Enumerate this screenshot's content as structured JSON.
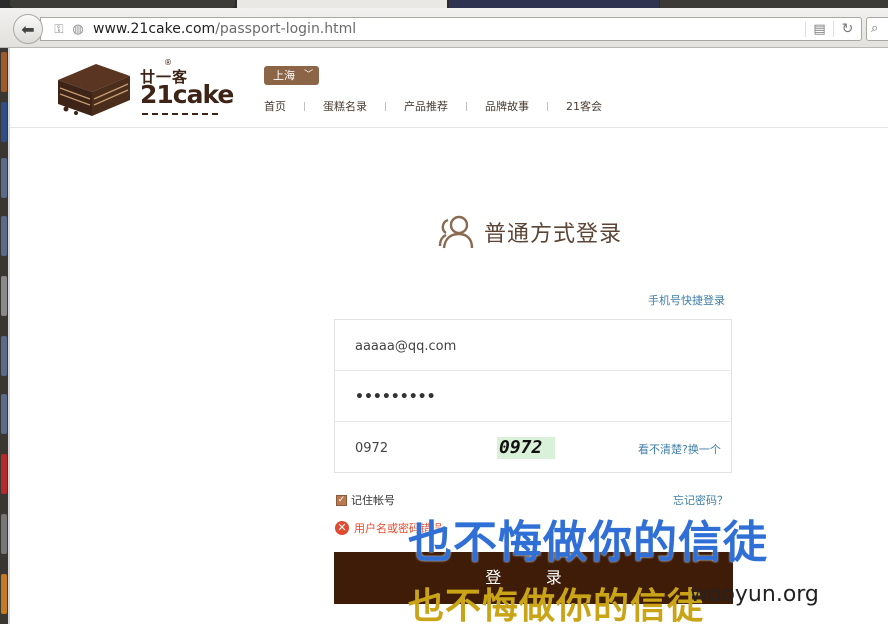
{
  "browser": {
    "url_host": "www.21cake.com",
    "url_path": "/passport-login.html"
  },
  "header": {
    "brand_cn": "廿一客",
    "brand_en": "21cake",
    "city": "上海",
    "nav": [
      "首页",
      "蛋糕名录",
      "产品推荐",
      "品牌故事",
      "21客会"
    ]
  },
  "login": {
    "title": "普通方式登录",
    "quick_login_link": "手机号快捷登录",
    "username_value": "aaaaa@qq.com",
    "password_mask": "•••••••••",
    "captcha_value": "0972",
    "captcha_image_text": "0972",
    "refresh_captcha": "看不清楚?换一个",
    "remember_label": "记住帐号",
    "forgot_link": "忘记密码？",
    "error_message": "用户名或密码错误",
    "submit_label": "登 录"
  },
  "watermark": {
    "line1": "也不悔做你的信徒",
    "line2": "也不悔做你的信徒",
    "site": "wooyun.org"
  },
  "colors": {
    "brand_brown": "#3d2416",
    "button_dark": "#3e1c08",
    "link_blue": "#3f7ea7",
    "error_red": "#e04a2f"
  }
}
